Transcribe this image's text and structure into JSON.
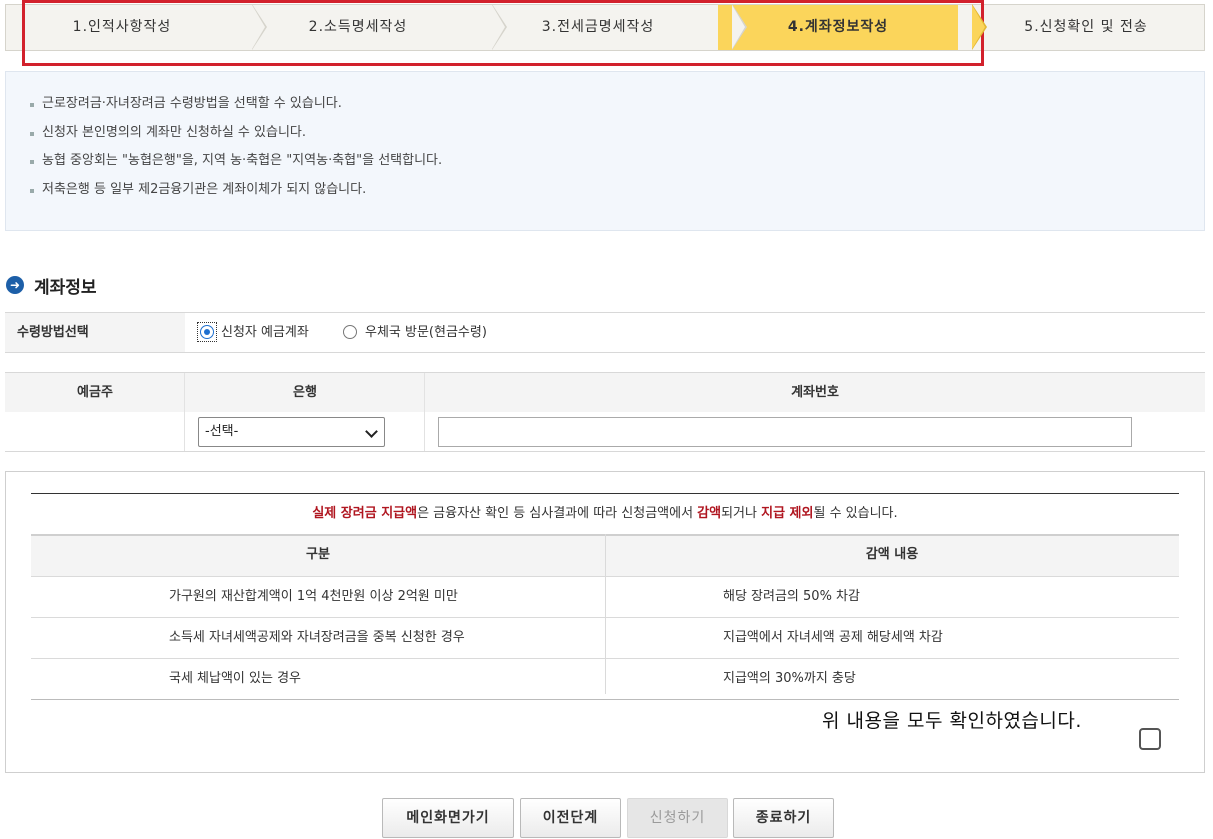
{
  "steps": [
    {
      "label": "1.인적사항작성"
    },
    {
      "label": "2.소득명세작성"
    },
    {
      "label": "3.전세금명세작성"
    },
    {
      "label": "4.계좌정보작성"
    },
    {
      "label": "5.신청확인 및 전송"
    }
  ],
  "active_step": 4,
  "info_notes": [
    "근로장려금·자녀장려금 수령방법을 선택할 수 있습니다.",
    "신청자 본인명의의 계좌만 신청하실 수 있습니다.",
    "농협 중앙회는 \"농협은행\"을, 지역 농·축협은 \"지역농·축협\"을 선택합니다.",
    "저축은행 등 일부 제2금융기관은 계좌이체가 되지 않습니다."
  ],
  "section_title": "계좌정보",
  "method": {
    "label": "수령방법선택",
    "options": [
      "신청자 예금계좌",
      "우체국 방문(현금수령)"
    ],
    "selected": "신청자 예금계좌"
  },
  "account": {
    "headers": {
      "holder": "예금주",
      "bank": "은행",
      "number": "계좌번호"
    },
    "holder_value": "",
    "bank_selected": "-선택-",
    "number_value": ""
  },
  "notice": {
    "msg_parts": {
      "a": "실제 장려금 지급액",
      "b": "은 금융자산 확인 등 심사결과에 따라 신청금액에서 ",
      "c": "감액",
      "d": "되거나 ",
      "e": "지급 제외",
      "f": "될 수 있습니다."
    },
    "headers": [
      "구분",
      "감액 내용"
    ],
    "rows": [
      [
        "가구원의 재산합계액이 1억 4천만원 이상 2억원 미만",
        "해당 장려금의 50% 차감"
      ],
      [
        "소득세 자녀세액공제와 자녀장려금을 중복 신청한 경우",
        "지급액에서 자녀세액 공제 해당세액 차감"
      ],
      [
        "국세 체납액이 있는 경우",
        "지급액의 30%까지 충당"
      ]
    ],
    "confirm_text": "위 내용을 모두 확인하였습니다."
  },
  "buttons": {
    "main": "메인화면가기",
    "prev": "이전단계",
    "apply": "신청하기",
    "close": "종료하기"
  },
  "colors": {
    "active_step": "#fbd55b",
    "highlight_border": "#d2212c",
    "emphasis_red": "#b01620",
    "section_icon": "#1d5fa8"
  }
}
